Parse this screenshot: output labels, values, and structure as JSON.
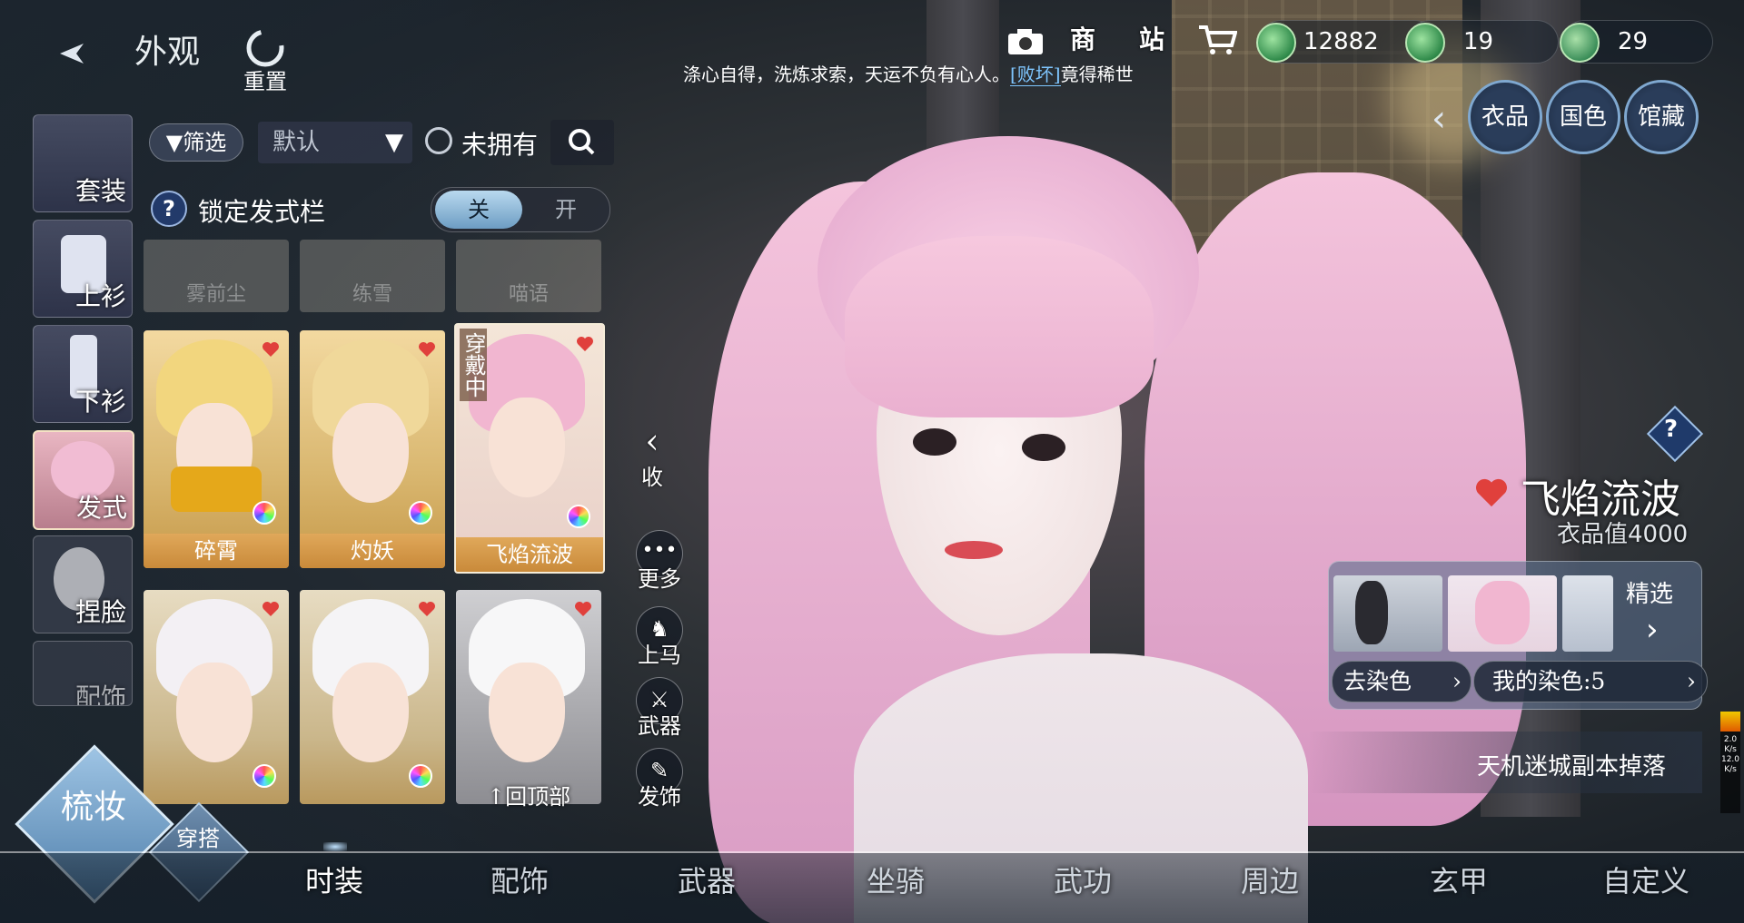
{
  "header": {
    "title": "外观",
    "reset_label": "重置",
    "shop_label": "商",
    "station_label": "站",
    "notice": "涤心自得，洗炼求索，天运不负有心人。",
    "notice_tag": "[败坏]",
    "notice_tail": "竟得稀世"
  },
  "currencies": [
    {
      "icon": "green-jade-icon",
      "value": "12882"
    },
    {
      "icon": "green-jade-icon",
      "value": "19"
    },
    {
      "icon": "green-jade-icon",
      "value": "29"
    }
  ],
  "category_buttons": [
    "衣品",
    "国色",
    "馆藏"
  ],
  "filter": {
    "filter_label": "筛选",
    "sort_value": "默认",
    "unowned_label": "未拥有",
    "lock_label": "锁定发式栏",
    "toggle_off": "关",
    "toggle_on": "开"
  },
  "side_tabs": [
    "套装",
    "上衫",
    "下衫",
    "发式",
    "捏脸",
    "配饰"
  ],
  "hair_row_faded": [
    "雾前尘",
    "练雪",
    "喵语"
  ],
  "hair_cards": [
    {
      "name": "碎霄",
      "wearing": false
    },
    {
      "name": "灼妖",
      "wearing": false
    },
    {
      "name": "飞焰流波",
      "wearing": true,
      "wearing_label": "穿戴中"
    },
    {
      "name": "",
      "wearing": false
    },
    {
      "name": "",
      "wearing": false
    },
    {
      "name": "",
      "wearing": false
    }
  ],
  "back_to_top": "回顶部",
  "vertical_buttons": {
    "collapse": "收",
    "more": "更多",
    "mount": "上马",
    "weapon": "武器",
    "hair_accessory": "发饰"
  },
  "item_info": {
    "name": "飞焰流波",
    "value_label": "衣品值4000",
    "featured_label": "精选",
    "remove_dye": "去染色",
    "my_dye": "我的染色:5",
    "source": "天机迷城副本掉落"
  },
  "mode_buttons": {
    "makeup": "梳妆",
    "outfit": "穿搭"
  },
  "bottom_tabs": [
    "时装",
    "配饰",
    "武器",
    "坐骑",
    "武功",
    "周边",
    "玄甲",
    "自定义"
  ],
  "perf": {
    "up": "2.0",
    "up_unit": "K/s",
    "down": "12.0",
    "down_unit": "K/s"
  },
  "colors": {
    "accent_pink": "#f2a9c8",
    "heart_red": "#e0403c",
    "card_gold": "#d9b770"
  }
}
